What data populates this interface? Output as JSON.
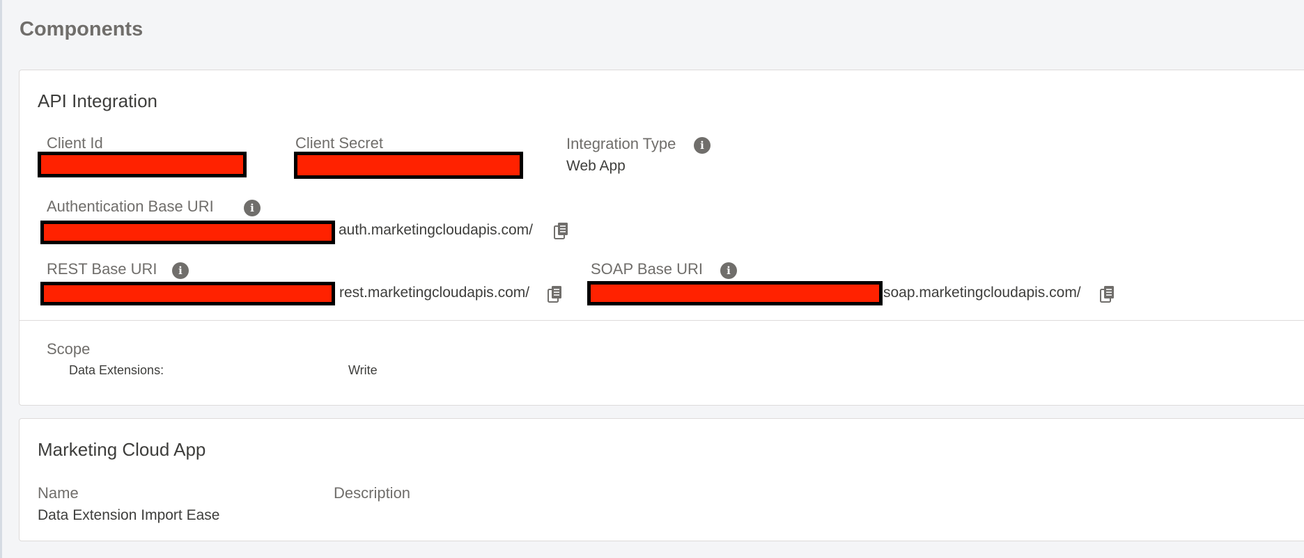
{
  "page": {
    "title": "Components"
  },
  "api_integration": {
    "title": "API Integration",
    "client_id_label": "Client Id",
    "client_secret_label": "Client Secret",
    "integration_type_label": "Integration Type",
    "integration_type_value": "Web App",
    "auth_uri_label": "Authentication Base URI",
    "auth_uri_suffix": "auth.marketingcloudapis.com/",
    "rest_uri_label": "REST Base URI",
    "rest_uri_suffix": "rest.marketingcloudapis.com/",
    "soap_uri_label": "SOAP Base URI",
    "soap_uri_suffix": "soap.marketingcloudapis.com/",
    "scope_label": "Scope",
    "scope": [
      {
        "name": "Data Extensions:",
        "permission": "Write"
      }
    ]
  },
  "marketing_cloud_app": {
    "title": "Marketing Cloud App",
    "name_label": "Name",
    "name_value": "Data Extension Import Ease",
    "description_label": "Description"
  },
  "icons": {
    "info": "info-icon",
    "copy": "copy-icon"
  },
  "colors": {
    "redaction": "#ff2200",
    "label": "#706e6b",
    "text": "#3e3e3c"
  }
}
